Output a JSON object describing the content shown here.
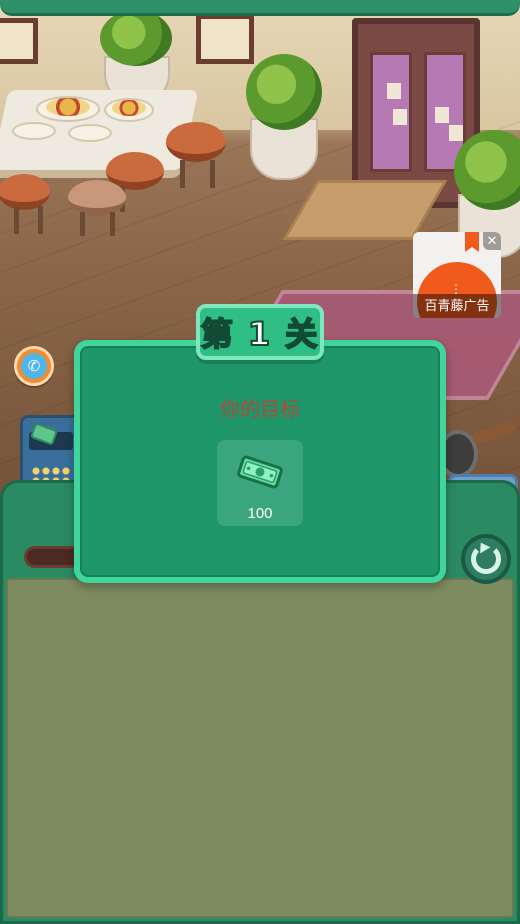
{
  "ad": {
    "label": "百青藤广告",
    "close_glyph": "✕"
  },
  "dialog": {
    "level_title": "第 1 关",
    "goal_label": "你的目标",
    "goal_item": {
      "icon": "cash-icon",
      "value": "100"
    }
  },
  "controls": {
    "phone_icon": "phone-icon",
    "refresh_icon": "refresh-icon"
  },
  "colors": {
    "panel_green": "#2a8a62",
    "dialog_green": "#1f956a",
    "dialog_border": "#3fd59b",
    "goal_text": "#b04a3a",
    "ad_orange": "#f05a1c",
    "panel_inner": "#7e8b60"
  }
}
